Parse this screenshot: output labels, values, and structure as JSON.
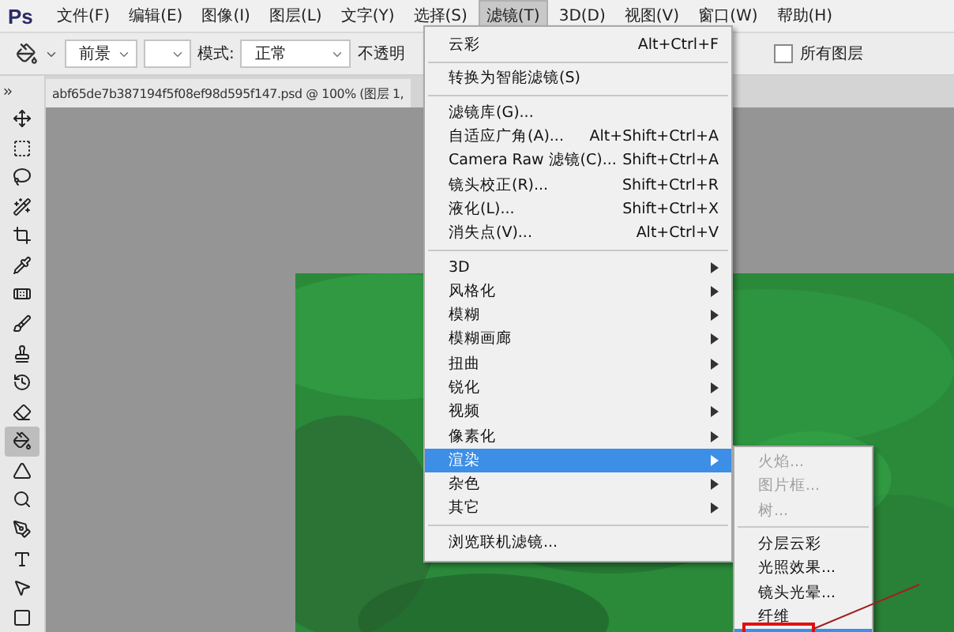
{
  "menubar": {
    "logo": "Ps",
    "items": [
      {
        "label": "文件(F)",
        "selected": false
      },
      {
        "label": "编辑(E)",
        "selected": false
      },
      {
        "label": "图像(I)",
        "selected": false
      },
      {
        "label": "图层(L)",
        "selected": false
      },
      {
        "label": "文字(Y)",
        "selected": false
      },
      {
        "label": "选择(S)",
        "selected": false
      },
      {
        "label": "滤镜(T)",
        "selected": true
      },
      {
        "label": "3D(D)",
        "selected": false
      },
      {
        "label": "视图(V)",
        "selected": false
      },
      {
        "label": "窗口(W)",
        "selected": false
      },
      {
        "label": "帮助(H)",
        "selected": false
      }
    ]
  },
  "options_bar": {
    "source": "前景",
    "mode_label": "模式:",
    "mode": "正常",
    "opacity_label": "不透明",
    "all_layers": {
      "label": "所有图层",
      "checked": false
    }
  },
  "document_tab": {
    "title": "abf65de7b387194f5f08ef98d595f147.psd @ 100% (图层 1,"
  },
  "tools": [
    {
      "selected": false
    },
    {
      "selected": false
    },
    {
      "selected": false
    },
    {
      "selected": false
    },
    {
      "selected": false
    },
    {
      "selected": false
    },
    {
      "selected": false
    },
    {
      "selected": false
    },
    {
      "selected": false
    },
    {
      "selected": false
    },
    {
      "selected": false
    },
    {
      "selected": true
    },
    {
      "selected": false
    },
    {
      "selected": false
    },
    {
      "selected": false
    },
    {
      "selected": false
    },
    {
      "selected": false
    },
    {
      "selected": false
    }
  ],
  "filter_menu": {
    "items": [
      {
        "kind": "item",
        "label": "云彩",
        "shortcut": "Alt+Ctrl+F",
        "selected": false
      },
      {
        "kind": "separator"
      },
      {
        "kind": "item",
        "label": "转换为智能滤镜(S)",
        "selected": false
      },
      {
        "kind": "separator"
      },
      {
        "kind": "item",
        "label": "滤镜库(G)...",
        "selected": false
      },
      {
        "kind": "item",
        "label": "自适应广角(A)...",
        "shortcut": "Alt+Shift+Ctrl+A",
        "selected": false
      },
      {
        "kind": "item",
        "label": "Camera Raw 滤镜(C)...",
        "shortcut": "Shift+Ctrl+A",
        "selected": false
      },
      {
        "kind": "item",
        "label": "镜头校正(R)...",
        "shortcut": "Shift+Ctrl+R",
        "selected": false
      },
      {
        "kind": "item",
        "label": "液化(L)...",
        "shortcut": "Shift+Ctrl+X",
        "selected": false
      },
      {
        "kind": "item",
        "label": "消失点(V)...",
        "shortcut": "Alt+Ctrl+V",
        "selected": false
      },
      {
        "kind": "separator"
      },
      {
        "kind": "submenu",
        "label": "3D",
        "selected": false
      },
      {
        "kind": "submenu",
        "label": "风格化",
        "selected": false
      },
      {
        "kind": "submenu",
        "label": "模糊",
        "selected": false
      },
      {
        "kind": "submenu",
        "label": "模糊画廊",
        "selected": false
      },
      {
        "kind": "submenu",
        "label": "扭曲",
        "selected": false
      },
      {
        "kind": "submenu",
        "label": "锐化",
        "selected": false
      },
      {
        "kind": "submenu",
        "label": "视频",
        "selected": false
      },
      {
        "kind": "submenu",
        "label": "像素化",
        "selected": false
      },
      {
        "kind": "submenu",
        "label": "渲染",
        "selected": true
      },
      {
        "kind": "submenu",
        "label": "杂色",
        "selected": false
      },
      {
        "kind": "submenu",
        "label": "其它",
        "selected": false
      },
      {
        "kind": "separator"
      },
      {
        "kind": "item",
        "label": "浏览联机滤镜...",
        "selected": false
      }
    ]
  },
  "render_submenu": {
    "items": [
      {
        "kind": "item",
        "label": "火焰...",
        "disabled": true,
        "selected": false
      },
      {
        "kind": "item",
        "label": "图片框...",
        "disabled": true,
        "selected": false
      },
      {
        "kind": "item",
        "label": "树...",
        "disabled": true,
        "selected": false
      },
      {
        "kind": "separator"
      },
      {
        "kind": "item",
        "label": "分层云彩",
        "disabled": false,
        "selected": false
      },
      {
        "kind": "item",
        "label": "光照效果...",
        "disabled": false,
        "selected": false
      },
      {
        "kind": "item",
        "label": "镜头光晕...",
        "disabled": false,
        "selected": false
      },
      {
        "kind": "item",
        "label": "纤维",
        "disabled": false,
        "selected": false
      },
      {
        "kind": "item",
        "disabled": false,
        "selected": true
      }
    ]
  },
  "annotation": {
    "kind": "highlight-box"
  }
}
